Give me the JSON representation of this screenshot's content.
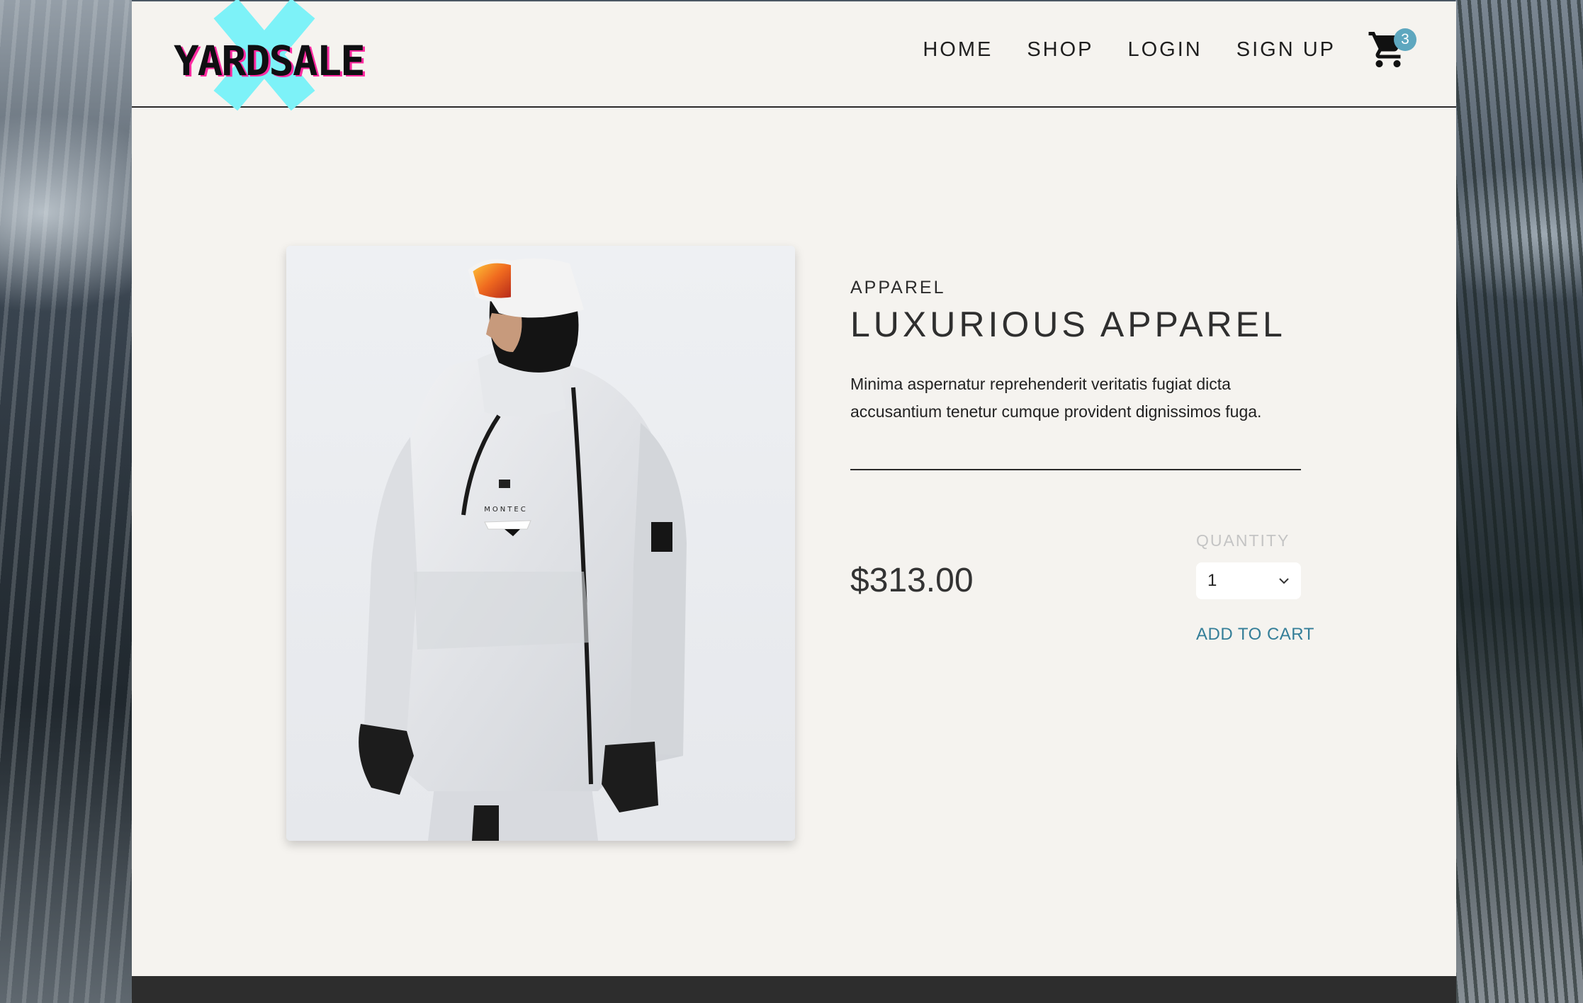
{
  "brand": {
    "logo_text": "YARDSALE"
  },
  "nav": {
    "items": [
      "HOME",
      "SHOP",
      "LOGIN",
      "SIGN UP"
    ]
  },
  "cart": {
    "count": "3",
    "icon": "cart-icon"
  },
  "product": {
    "category": "APPAREL",
    "title": "LUXURIOUS APPAREL",
    "description": "Minima aspernatur reprehenderit veritatis fugiat dicta accusantium tenetur cumque provident dignissimos fuga.",
    "price": "$313.00",
    "quantity_label": "QUANTITY",
    "quantity_value": "1",
    "add_to_cart_label": "ADD TO CART",
    "image_alt": "Model wearing white MONTEC ski jacket",
    "image_brand_text": "MONTEC"
  },
  "colors": {
    "accent": "#347e98",
    "badge": "#5ea7bf",
    "logo_x": "#7df2f8",
    "logo_shadow": "#ff2aa1",
    "page_bg": "#f5f3ef"
  }
}
